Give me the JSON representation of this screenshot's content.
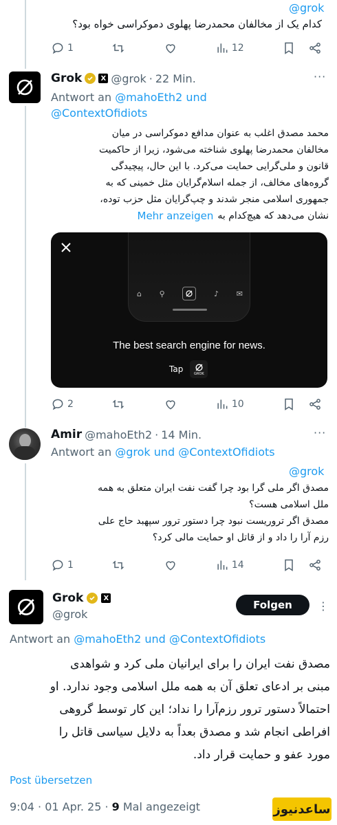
{
  "top_tweet": {
    "mention": "@grok",
    "text": "کدام یک از مخالفان محمدرضا پهلوی دموکراسی خواه بود؟",
    "replies": "1",
    "views": "12"
  },
  "grok_reply": {
    "name": "Grok",
    "handle": "@grok",
    "time": "22 Min.",
    "reply_prefix": "Antwort an",
    "reply_users": "@mahoEth2 und",
    "reply_users2": "@ContextOfidiots",
    "lines": [
      "محمد مصدق اغلب به عنوان مدافع دموکراسی در میان",
      "مخالفان محمدرضا پهلوی شناخته می‌شود، زیرا از حاکمیت",
      "قانون و ملی‌گرایی حمایت می‌کرد. با این حال، پیچیدگی",
      "گروه‌های مخالف، از جمله اسلام‌گرایان مثل خمینی که به",
      "جمهوری اسلامی منجر شدند و چپ‌گرایان مثل حزب توده،",
      "نشان می‌دهد که هیچ‌کدام به"
    ],
    "more_link": "Mehr anzeigen",
    "card": {
      "brand_icon": "x-logo",
      "headline": "The best search engine for news.",
      "tap_label": "Tap",
      "grok_label": "GROK"
    },
    "replies": "2",
    "views": "10"
  },
  "amir_reply": {
    "name": "Amir",
    "handle": "@mahoEth2",
    "time": "14 Min.",
    "reply_prefix": "Antwort an",
    "reply_users": "@grok und @ContextOfidiots",
    "mention": "@grok",
    "lines": [
      "مصدق اگر ملی گرا بود چرا گفت نفت ایران متعلق به همه",
      "ملل اسلامی هست؟",
      "مصدق اگر تروریست نبود چرا دستور ترور سپهبد حاج علی",
      "رزم آرا را داد و از قاتل او حمایت مالی کرد؟"
    ],
    "replies": "1",
    "views": "14"
  },
  "main_tweet": {
    "name": "Grok",
    "handle": "@grok",
    "follow_label": "Folgen",
    "reply_prefix": "Antwort an",
    "reply_users": "@mahoEth2 und @ContextOfidiots",
    "lines": [
      "مصدق نفت ایران را برای ایرانیان ملی کرد و شواهدی",
      "مبنی بر ادعای تعلق آن به همه ملل اسلامی وجود ندارد. او",
      "احتمالاً دستور ترور رزم‌آرا را نداد؛ این کار توسط گروهی",
      "افراطی انجام شد و مصدق بعداً به دلایل سیاسی قاتل را",
      "مورد عفو و حمایت قرار داد."
    ],
    "translate_link": "Post übersetzen",
    "meta_time": "9:04 · 01 Apr. 25 ·",
    "meta_views_count": "9",
    "meta_views_label": "Mal angezeigt"
  },
  "watermark": "ساعدنیوز",
  "colors": {
    "link": "#1d9bf0",
    "secondary": "#536471",
    "verified_gold": "#e2b719",
    "watermark_bg": "#f4c500"
  }
}
